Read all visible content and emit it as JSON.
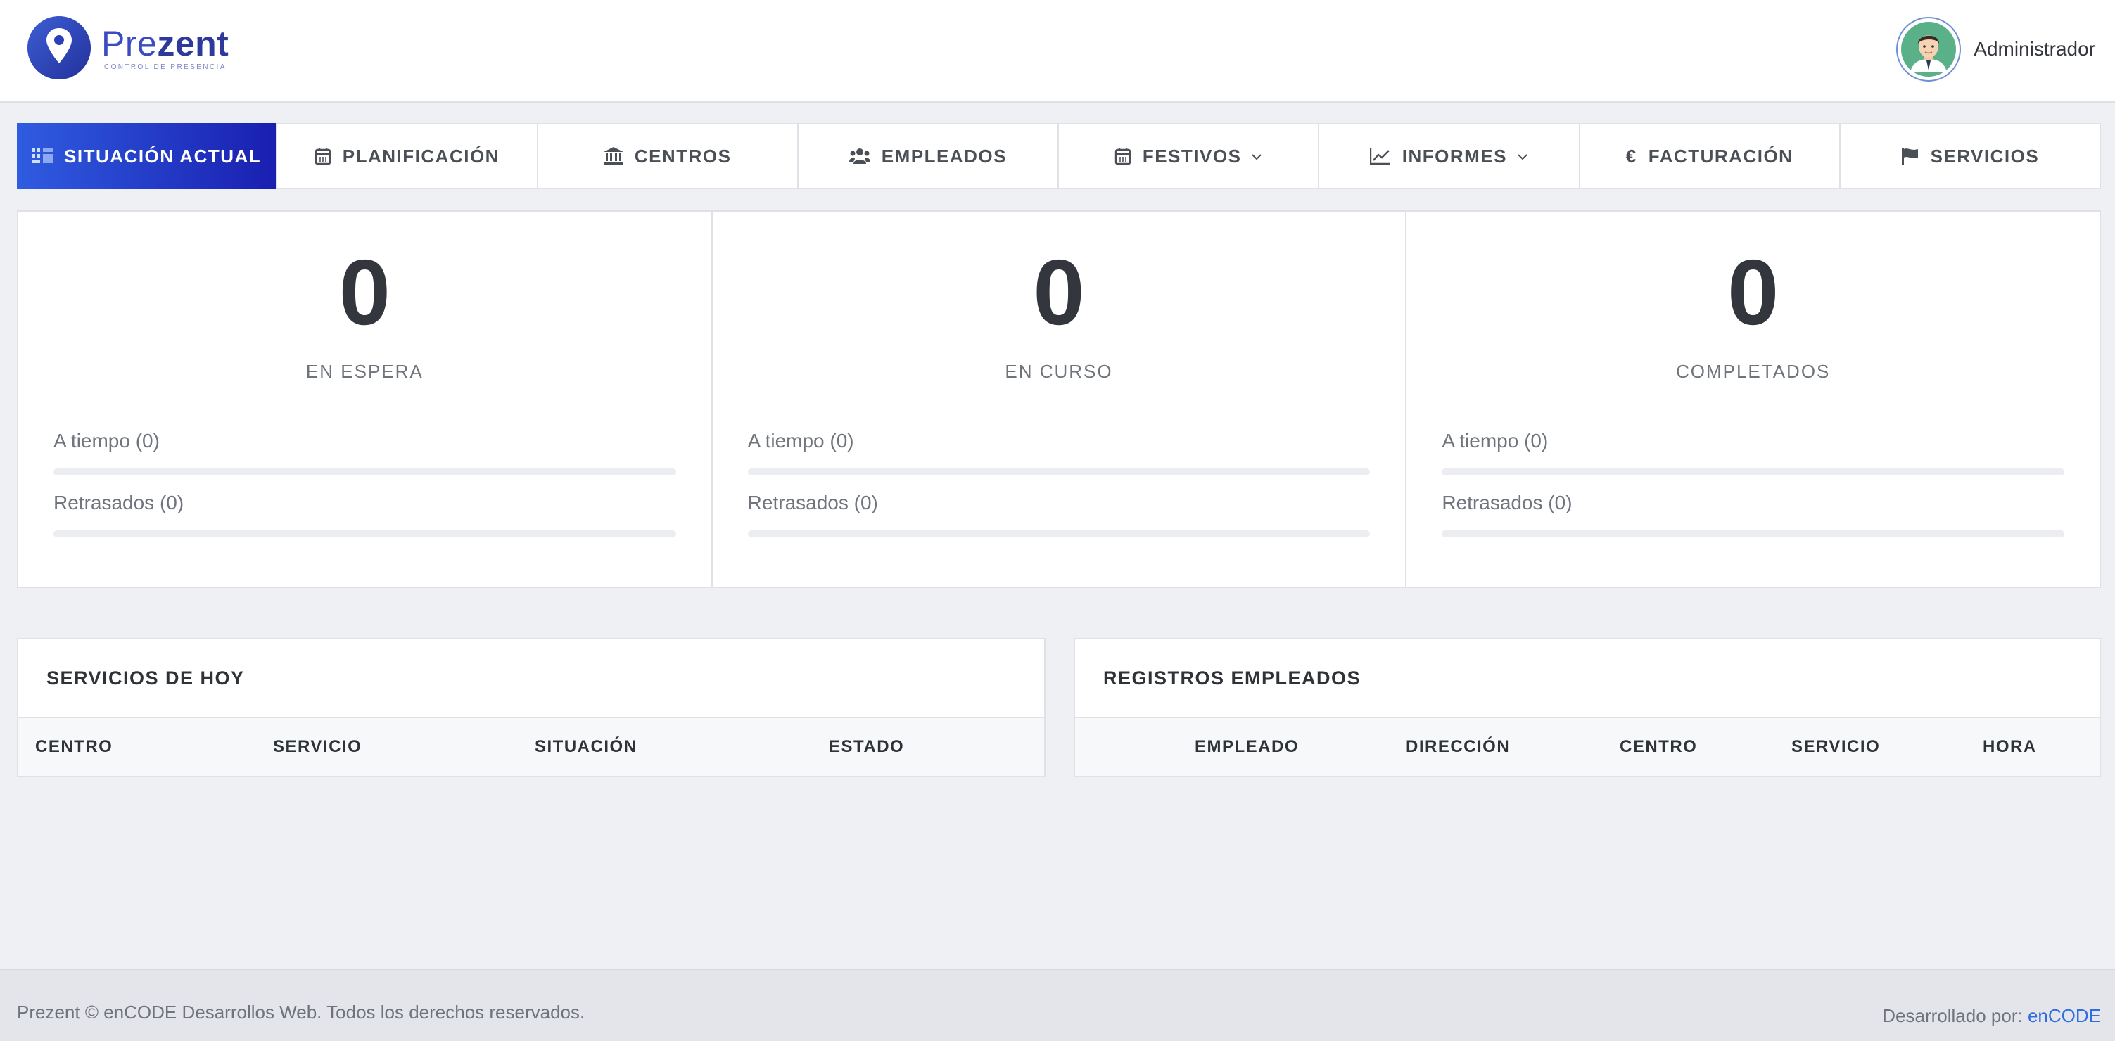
{
  "header": {
    "logo_name_prefix": "Pre",
    "logo_name_suffix": "zent",
    "logo_tagline": "CONTROL DE PRESENCIA",
    "user_name": "Administrador"
  },
  "nav": {
    "items": [
      {
        "label": "SITUACIÓN ACTUAL",
        "icon": "dashboard-icon",
        "active": true
      },
      {
        "label": "PLANIFICACIÓN",
        "icon": "calendar-icon"
      },
      {
        "label": "CENTROS",
        "icon": "bank-icon"
      },
      {
        "label": "EMPLEADOS",
        "icon": "users-icon"
      },
      {
        "label": "FESTIVOS",
        "icon": "calendar-icon",
        "dropdown": true
      },
      {
        "label": "INFORMES",
        "icon": "line-chart-icon",
        "dropdown": true
      },
      {
        "label": "FACTURACIÓN",
        "icon": "euro-icon",
        "icon_glyph": "€"
      },
      {
        "label": "SERVICIOS",
        "icon": "flag-icon"
      }
    ],
    "active_color": "#2f5ce0"
  },
  "stats": [
    {
      "value": "0",
      "label": "EN ESPERA",
      "on_time": "A tiempo (0)",
      "on_time_pct": 0,
      "delayed": "Retrasados (0)",
      "delayed_pct": 0
    },
    {
      "value": "0",
      "label": "EN CURSO",
      "on_time": "A tiempo (0)",
      "on_time_pct": 0,
      "delayed": "Retrasados (0)",
      "delayed_pct": 0
    },
    {
      "value": "0",
      "label": "COMPLETADOS",
      "on_time": "A tiempo (0)",
      "on_time_pct": 0,
      "delayed": "Retrasados (0)",
      "delayed_pct": 0
    }
  ],
  "services_today": {
    "title": "SERVICIOS DE HOY",
    "columns": [
      "CENTRO",
      "SERVICIO",
      "SITUACIÓN",
      "ESTADO"
    ],
    "rows": []
  },
  "employee_records": {
    "title": "REGISTROS EMPLEADOS",
    "columns": [
      "EMPLEADO",
      "DIRECCIÓN",
      "CENTRO",
      "SERVICIO",
      "HORA"
    ],
    "rows": []
  },
  "footer": {
    "copyright": "Prezent © enCODE Desarrollos Web. Todos los derechos reservados.",
    "developed_by": "Desarrollado por:",
    "developer_link": "enCODE"
  }
}
